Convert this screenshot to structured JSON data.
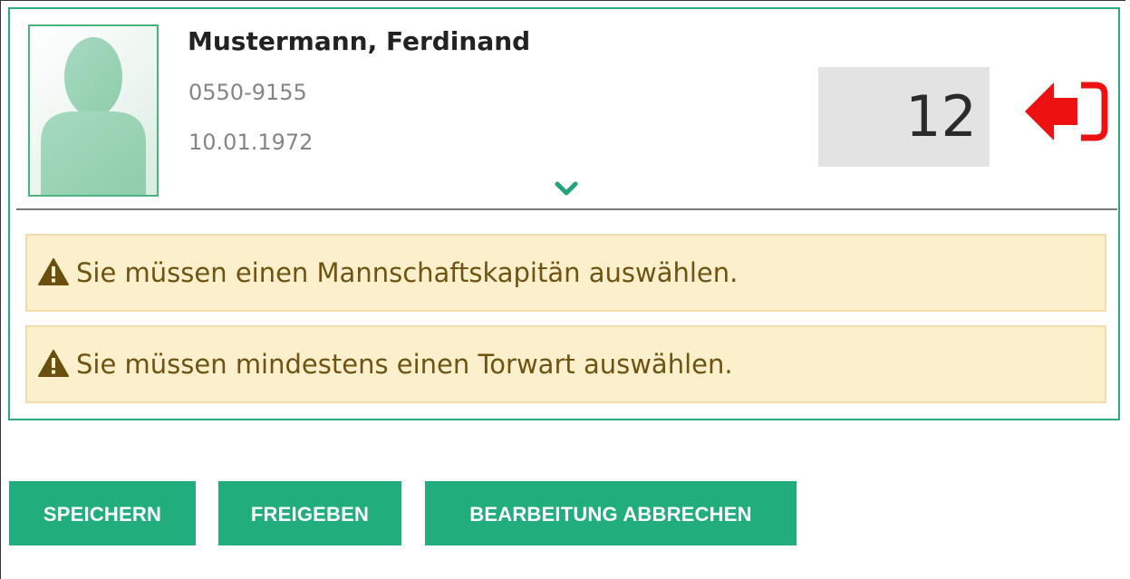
{
  "player": {
    "name": "Mustermann, Ferdinand",
    "id_number": "0550-9155",
    "birth_date": "10.01.1972",
    "shirt_number": "12"
  },
  "warnings": [
    {
      "text": "Sie müssen einen Mannschaftskapitän auswählen."
    },
    {
      "text": "Sie müssen mindestens einen Torwart auswählen."
    }
  ],
  "actions": {
    "save_label": "SPEICHERN",
    "release_label": "FREIGEBEN",
    "cancel_label": "BEARBEITUNG ABBRECHEN"
  },
  "icons": {
    "avatar": "person-silhouette-icon",
    "remove": "sign-out-icon",
    "expand": "chevron-down-icon",
    "warning": "warning-triangle-icon"
  },
  "colors": {
    "accent_green": "#22ae7c",
    "panel_border": "#2eaa80",
    "remove_red": "#ee1111",
    "warning_bg": "#fcf0cc",
    "warning_text": "#6e5312"
  }
}
